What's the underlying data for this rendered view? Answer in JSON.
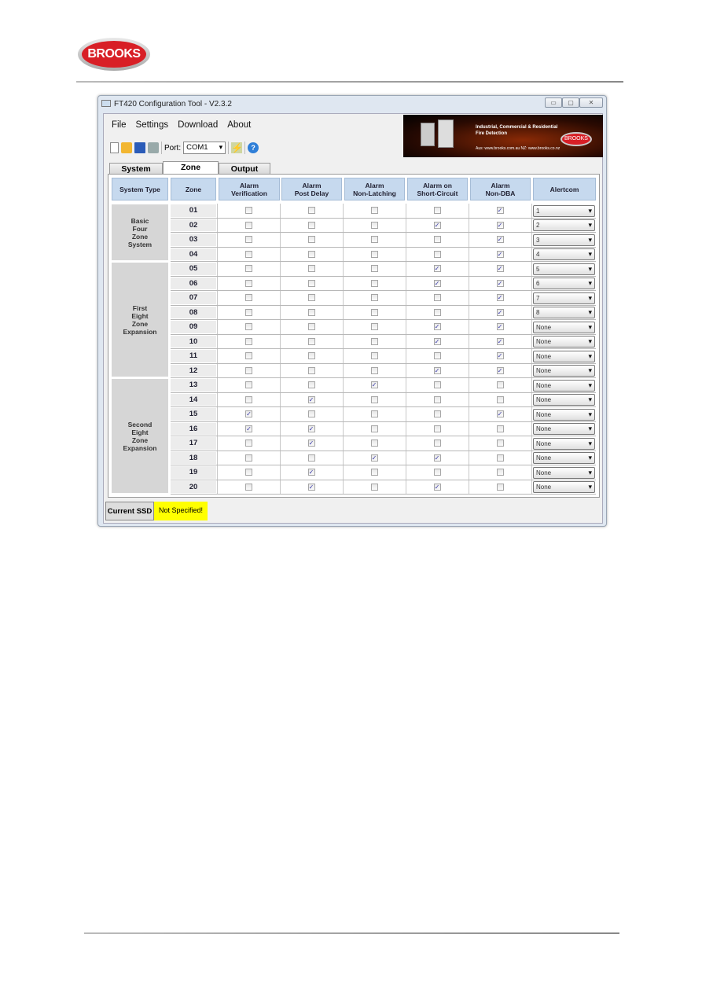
{
  "logo": {
    "text": "BROOKS",
    "color": "#d81f26"
  },
  "window": {
    "title": "FT420 Configuration Tool - V2.3.2",
    "controls": [
      "minimize",
      "maximize",
      "close"
    ]
  },
  "menu": [
    "File",
    "Settings",
    "Download",
    "About"
  ],
  "toolbar": {
    "icons": [
      "new-file-icon",
      "open-folder-icon",
      "save-icon",
      "print-icon"
    ],
    "port_label": "Port:",
    "port_value": "COM1",
    "connect_icon": "lightning-icon",
    "help_icon": "help-icon"
  },
  "banner": {
    "line1": "Industrial, Commercial & Residential",
    "line2": "Fire Detection",
    "urls": "Aus: www.brooks.com.au   NZ: www.brooks.co.nz",
    "brand": "BROOKS"
  },
  "tabs": [
    {
      "label": "System"
    },
    {
      "label": "Zone",
      "active": true
    },
    {
      "label": "Output"
    }
  ],
  "headers": [
    "System Type",
    "Zone",
    "Alarm\nVerification",
    "Alarm\nPost Delay",
    "Alarm\nNon-Latching",
    "Alarm on\nShort-Circuit",
    "Alarm\nNon-DBA",
    "Alertcom"
  ],
  "groups": [
    {
      "label": "Basic\nFour\nZone\nSystem",
      "rows": 4
    },
    {
      "label": "First\nEight\nZone\nExpansion",
      "rows": 8
    },
    {
      "label": "Second\nEight\nZone\nExpansion",
      "rows": 8
    }
  ],
  "zones": [
    {
      "zone": "01",
      "flags": [
        0,
        0,
        0,
        0,
        1
      ],
      "alertcom": "1"
    },
    {
      "zone": "02",
      "flags": [
        0,
        0,
        0,
        1,
        1
      ],
      "alertcom": "2"
    },
    {
      "zone": "03",
      "flags": [
        0,
        0,
        0,
        0,
        1
      ],
      "alertcom": "3"
    },
    {
      "zone": "04",
      "flags": [
        0,
        0,
        0,
        0,
        1
      ],
      "alertcom": "4"
    },
    {
      "zone": "05",
      "flags": [
        0,
        0,
        0,
        1,
        1
      ],
      "alertcom": "5"
    },
    {
      "zone": "06",
      "flags": [
        0,
        0,
        0,
        1,
        1
      ],
      "alertcom": "6"
    },
    {
      "zone": "07",
      "flags": [
        0,
        0,
        0,
        0,
        1
      ],
      "alertcom": "7"
    },
    {
      "zone": "08",
      "flags": [
        0,
        0,
        0,
        0,
        1
      ],
      "alertcom": "8"
    },
    {
      "zone": "09",
      "flags": [
        0,
        0,
        0,
        1,
        1
      ],
      "alertcom": "None"
    },
    {
      "zone": "10",
      "flags": [
        0,
        0,
        0,
        1,
        1
      ],
      "alertcom": "None"
    },
    {
      "zone": "11",
      "flags": [
        0,
        0,
        0,
        0,
        1
      ],
      "alertcom": "None"
    },
    {
      "zone": "12",
      "flags": [
        0,
        0,
        0,
        1,
        1
      ],
      "alertcom": "None"
    },
    {
      "zone": "13",
      "flags": [
        0,
        0,
        1,
        0,
        0
      ],
      "alertcom": "None"
    },
    {
      "zone": "14",
      "flags": [
        0,
        1,
        0,
        0,
        0
      ],
      "alertcom": "None"
    },
    {
      "zone": "15",
      "flags": [
        1,
        0,
        0,
        0,
        1
      ],
      "alertcom": "None"
    },
    {
      "zone": "16",
      "flags": [
        1,
        1,
        0,
        0,
        0
      ],
      "alertcom": "None"
    },
    {
      "zone": "17",
      "flags": [
        0,
        1,
        0,
        0,
        0
      ],
      "alertcom": "None"
    },
    {
      "zone": "18",
      "flags": [
        0,
        0,
        1,
        1,
        0
      ],
      "alertcom": "None"
    },
    {
      "zone": "19",
      "flags": [
        0,
        1,
        0,
        0,
        0
      ],
      "alertcom": "None"
    },
    {
      "zone": "20",
      "flags": [
        0,
        1,
        0,
        1,
        0
      ],
      "alertcom": "None"
    }
  ],
  "status": {
    "label": "Current SSD",
    "value": "Not Specified!",
    "value_bg": "#ffff00"
  }
}
